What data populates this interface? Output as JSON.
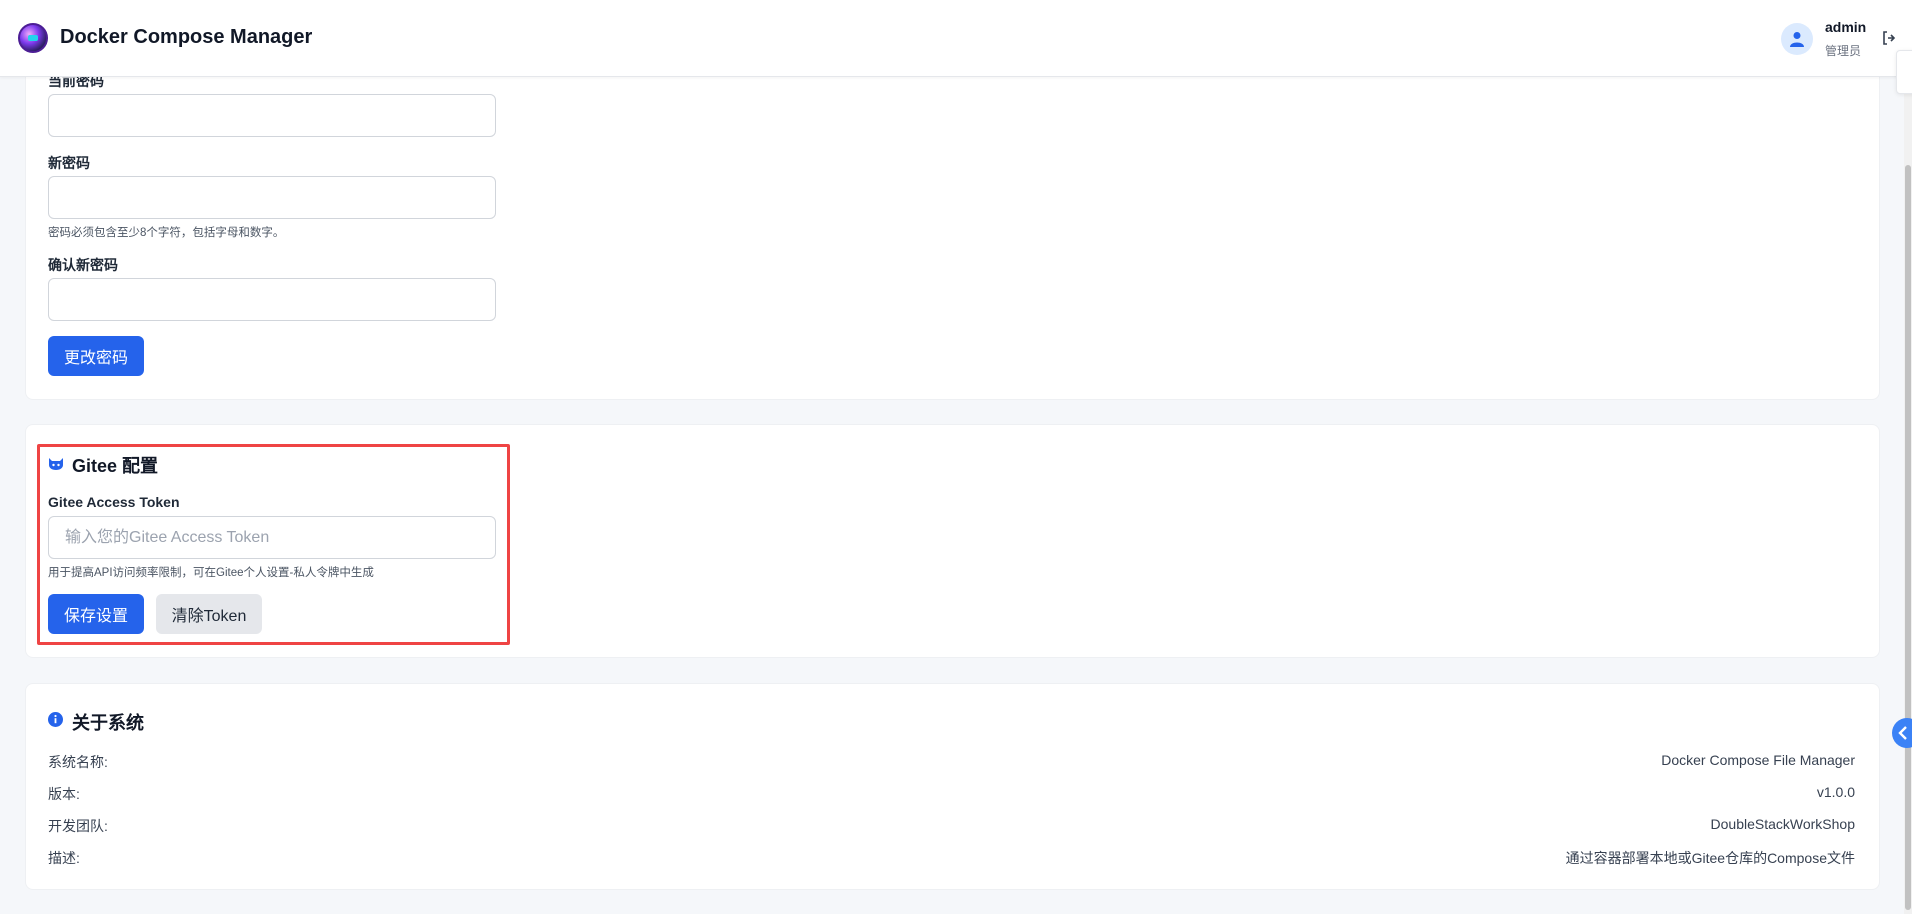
{
  "header": {
    "app_title": "Docker Compose Manager",
    "user_name": "admin",
    "user_role": "管理员"
  },
  "password_section": {
    "current_label": "当前密码",
    "new_label": "新密码",
    "new_hint": "密码必须包含至少8个字符，包括字母和数字。",
    "confirm_label": "确认新密码",
    "current_value": "",
    "new_value": "",
    "confirm_value": "",
    "submit_label": "更改密码"
  },
  "gitee_section": {
    "title": "Gitee 配置",
    "token_label": "Gitee Access Token",
    "token_value": "",
    "token_placeholder": "输入您的Gitee Access Token",
    "token_hint": "用于提高API访问频率限制，可在Gitee个人设置-私人令牌中生成",
    "save_label": "保存设置",
    "clear_label": "清除Token"
  },
  "about_section": {
    "title": "关于系统",
    "rows": [
      {
        "key": "系统名称:",
        "value": "Docker Compose File Manager"
      },
      {
        "key": "版本:",
        "value": "v1.0.0"
      },
      {
        "key": "开发团队:",
        "value": "DoubleStackWorkShop"
      },
      {
        "key": "描述:",
        "value": "通过容器部署本地或Gitee仓库的Compose文件"
      }
    ]
  },
  "colors": {
    "primary": "#2563eb",
    "highlight": "#ef4444",
    "background": "#f5f7fa"
  }
}
